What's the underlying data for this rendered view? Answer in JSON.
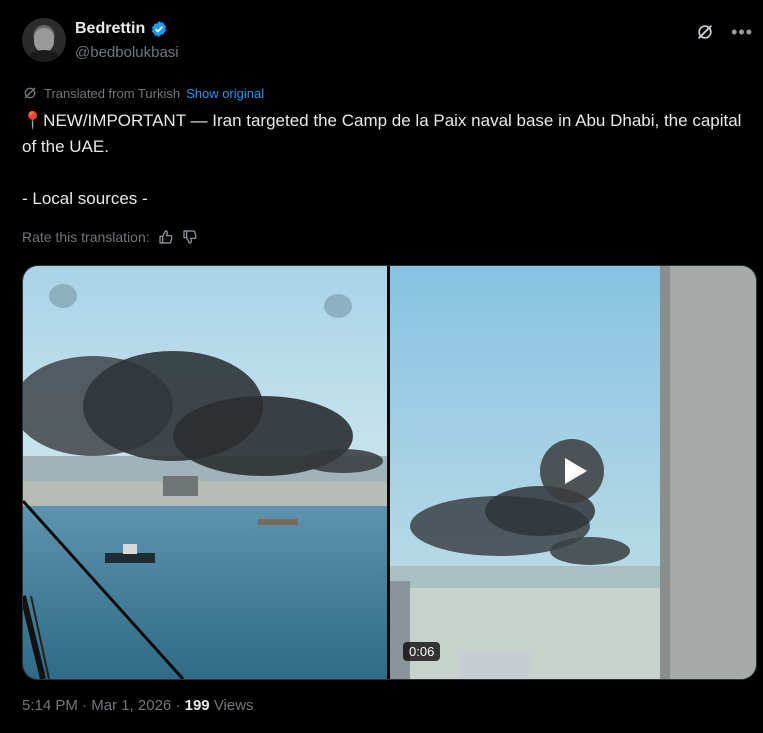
{
  "author": {
    "display_name": "Bedrettin",
    "handle": "@bedbolukbasi",
    "verified": true
  },
  "translation": {
    "label": "Translated from Turkish",
    "show_original": "Show original"
  },
  "tweet": {
    "pin_emoji": "📍",
    "text": "NEW/IMPORTANT — Iran targeted the Camp de la Paix naval base in Abu Dhabi, the capital of the UAE.\n\n- Local sources -"
  },
  "rate": {
    "label": "Rate this translation:"
  },
  "media": {
    "video_duration": "0:06"
  },
  "meta": {
    "time": "5:14 PM",
    "separator": "·",
    "date": "Mar 1, 2026",
    "views_count": "199",
    "views_label": "Views"
  },
  "icons": {
    "top_right": [
      "grok-icon",
      "more-icon"
    ],
    "verified": "verified-badge-icon"
  },
  "colors": {
    "background": "#000000",
    "text": "#e7e9ea",
    "muted": "#71767b",
    "link": "#1d9bf0",
    "verified": "#1d9bf0"
  }
}
